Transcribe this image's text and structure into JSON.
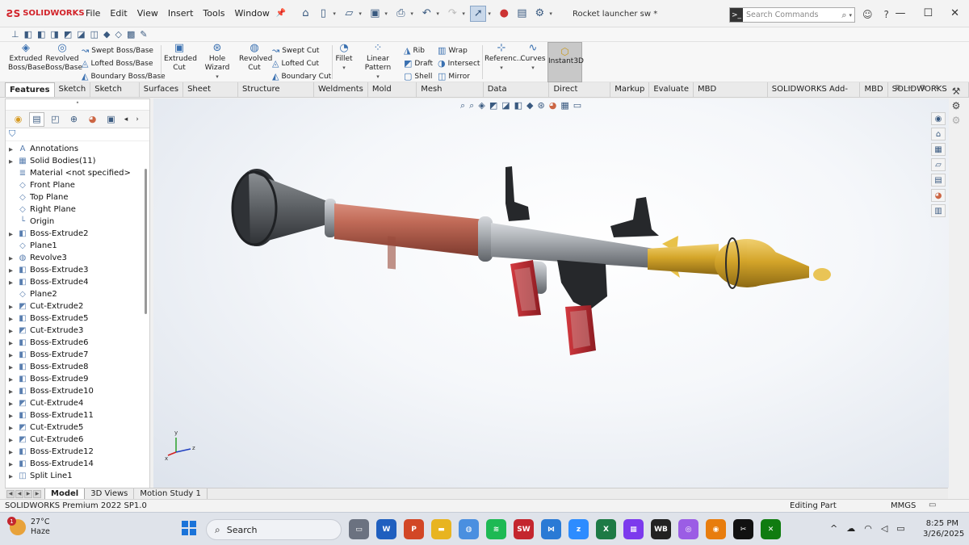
{
  "app": {
    "brand": "SOLIDWORKS",
    "menu": [
      "File",
      "Edit",
      "View",
      "Insert",
      "Tools",
      "Window"
    ],
    "document_title": "Rocket launcher sw *",
    "search_placeholder": "Search Commands"
  },
  "ribbon": {
    "extruded_boss": [
      "Extruded",
      "Boss/Base"
    ],
    "revolved_boss": [
      "Revolved",
      "Boss/Base"
    ],
    "swept_boss": "Swept Boss/Base",
    "lofted_boss": "Lofted Boss/Base",
    "boundary_boss": "Boundary Boss/Base",
    "extruded_cut": [
      "Extruded",
      "Cut"
    ],
    "hole_wizard": "Hole Wizard",
    "revolved_cut": [
      "Revolved",
      "Cut"
    ],
    "swept_cut": "Swept Cut",
    "lofted_cut": "Lofted Cut",
    "boundary_cut": "Boundary Cut",
    "fillet": "Fillet",
    "linear_pattern": "Linear Pattern",
    "rib": "Rib",
    "draft": "Draft",
    "shell": "Shell",
    "wrap": "Wrap",
    "intersect": "Intersect",
    "mirror": "Mirror",
    "reference": "Referenc...",
    "curves": "Curves",
    "instant3d": "Instant3D"
  },
  "tabs": [
    "Features",
    "Sketch",
    "Sketch Ink",
    "Surfaces",
    "Sheet Metal",
    "Structure System",
    "Weldments",
    "Mold Tools",
    "Mesh Modeling",
    "Data Migration",
    "Direct Editing",
    "Markup",
    "Evaluate",
    "MBD Dimensions",
    "SOLIDWORKS Add-Ins",
    "MBD",
    "SOLIDWORKS CAM"
  ],
  "tree": [
    {
      "label": "Annotations",
      "expandable": true
    },
    {
      "label": "Solid Bodies(11)",
      "expandable": true
    },
    {
      "label": "Material <not specified>",
      "expandable": false
    },
    {
      "label": "Front Plane",
      "expandable": false
    },
    {
      "label": "Top Plane",
      "expandable": false
    },
    {
      "label": "Right Plane",
      "expandable": false
    },
    {
      "label": "Origin",
      "expandable": false
    },
    {
      "label": "Boss-Extrude2",
      "expandable": true
    },
    {
      "label": "Plane1",
      "expandable": false
    },
    {
      "label": "Revolve3",
      "expandable": true
    },
    {
      "label": "Boss-Extrude3",
      "expandable": true
    },
    {
      "label": "Boss-Extrude4",
      "expandable": true
    },
    {
      "label": "Plane2",
      "expandable": false
    },
    {
      "label": "Cut-Extrude2",
      "expandable": true
    },
    {
      "label": "Boss-Extrude5",
      "expandable": true
    },
    {
      "label": "Cut-Extrude3",
      "expandable": true
    },
    {
      "label": "Boss-Extrude6",
      "expandable": true
    },
    {
      "label": "Boss-Extrude7",
      "expandable": true
    },
    {
      "label": "Boss-Extrude8",
      "expandable": true
    },
    {
      "label": "Boss-Extrude9",
      "expandable": true
    },
    {
      "label": "Boss-Extrude10",
      "expandable": true
    },
    {
      "label": "Cut-Extrude4",
      "expandable": true
    },
    {
      "label": "Boss-Extrude11",
      "expandable": true
    },
    {
      "label": "Cut-Extrude5",
      "expandable": true
    },
    {
      "label": "Cut-Extrude6",
      "expandable": true
    },
    {
      "label": "Boss-Extrude12",
      "expandable": true
    },
    {
      "label": "Boss-Extrude14",
      "expandable": true
    },
    {
      "label": "Split Line1",
      "expandable": true
    }
  ],
  "bottom_tabs": [
    "Model",
    "3D Views",
    "Motion Study 1"
  ],
  "status": {
    "version": "SOLIDWORKS Premium 2022 SP1.0",
    "mode": "Editing Part",
    "units": "MMGS"
  },
  "triad": {
    "x": "x",
    "y": "y",
    "z": "z"
  },
  "taskbar": {
    "temp": "27°C",
    "condition": "Haze",
    "weather_badge": "1",
    "search_label": "Search",
    "time": "8:25 PM",
    "date": "3/26/2025"
  },
  "colors": {
    "brand_red": "#d2232a",
    "body_pipe": "#b9614f",
    "warhead": "#d4a52a",
    "grip": "#b8262e",
    "metal": "#a9adb2"
  }
}
